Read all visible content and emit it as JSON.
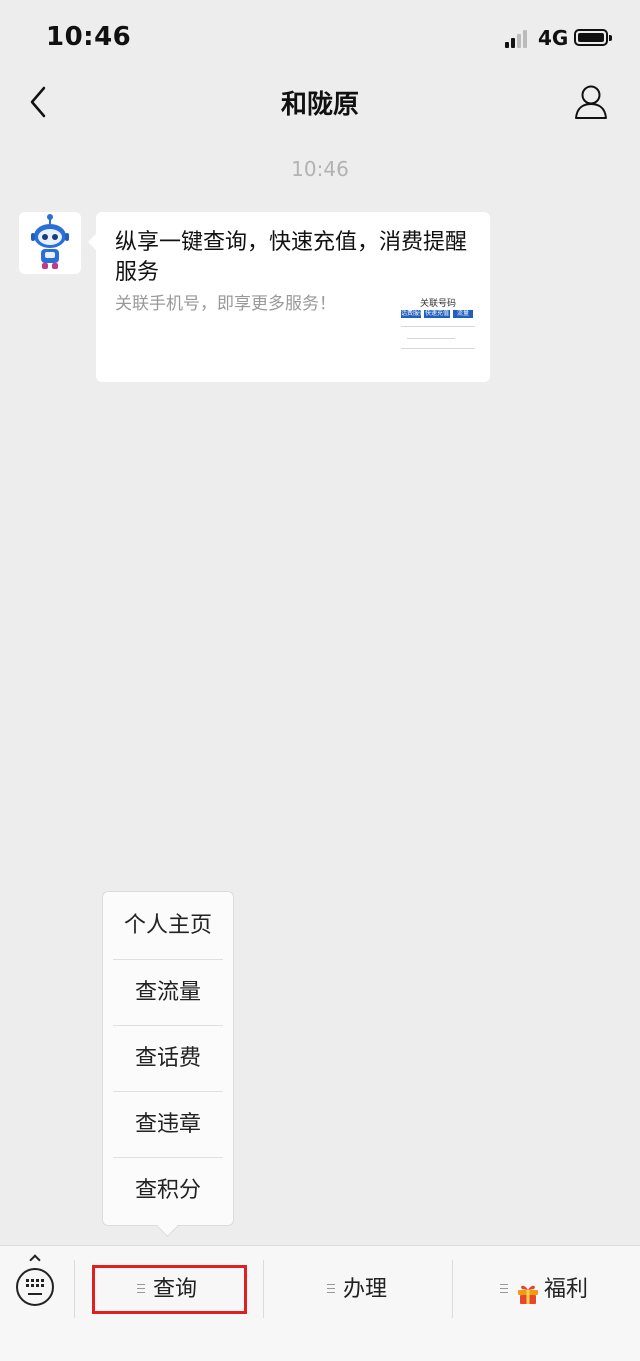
{
  "status_bar": {
    "time": "10:46",
    "network": "4G"
  },
  "nav": {
    "title": "和陇原"
  },
  "chat": {
    "timestamp": "10:46",
    "card": {
      "title": "纵享一键查询，快速充值，消费提醒服务",
      "description": "关联手机号，即享更多服务！",
      "thumb_title": "关联号码",
      "thumb_buttons": [
        "话费服务",
        "快速充值",
        "流量"
      ]
    }
  },
  "popup_menu": {
    "items": [
      "个人主页",
      "查流量",
      "查话费",
      "查违章",
      "查积分"
    ]
  },
  "bottom_menu": {
    "tabs": [
      {
        "label": "查询",
        "icon": "menu-lines-icon"
      },
      {
        "label": "办理",
        "icon": "menu-lines-icon"
      },
      {
        "label": "福利",
        "icon": "gift-icon"
      }
    ],
    "highlight_color": "#e02020"
  },
  "colors": {
    "background": "#ededed",
    "card": "#ffffff",
    "timestamp": "#b2b2b2"
  }
}
